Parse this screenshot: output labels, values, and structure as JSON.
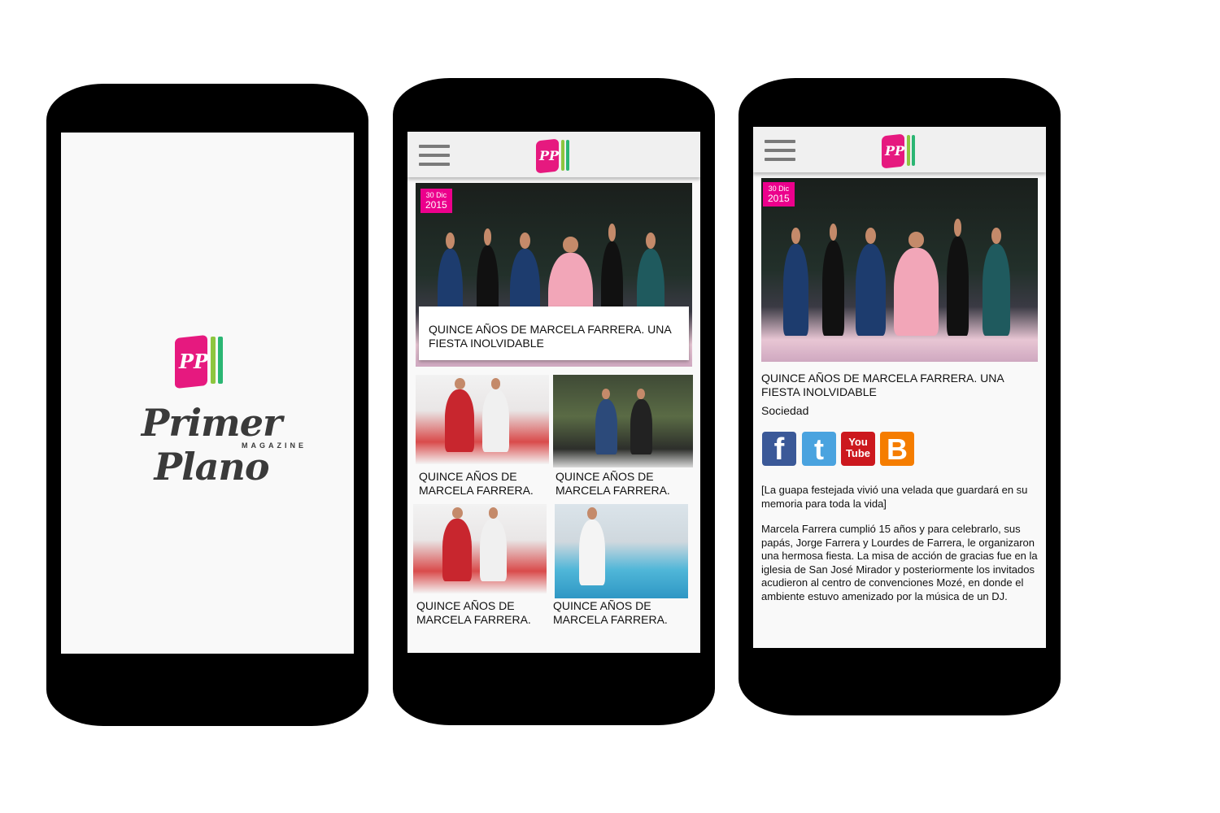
{
  "splash": {
    "logo_mark": "PP",
    "wordmark": "Primer Plano",
    "subtitle": "MAGAZINE"
  },
  "header": {
    "menu_icon": "hamburger-icon",
    "logo_mark": "PP"
  },
  "feed": {
    "hero": {
      "date_day": "30 Dic",
      "date_year": "2015",
      "title": "QUINCE AÑOS DE MARCELA FARRERA. UNA FIESTA INOLVIDABLE"
    },
    "cards": [
      {
        "title": "QUINCE AÑOS DE MARCELA FARRERA."
      },
      {
        "title": "QUINCE AÑOS DE MARCELA FARRERA."
      },
      {
        "title": "QUINCE AÑOS DE MARCELA FARRERA."
      },
      {
        "title": "QUINCE AÑOS DE MARCELA FARRERA."
      }
    ]
  },
  "article": {
    "date_day": "30 Dic",
    "date_year": "2015",
    "title": "QUINCE AÑOS DE MARCELA FARRERA. UNA FIESTA INOLVIDABLE",
    "category": "Sociedad",
    "social": {
      "facebook": "f",
      "twitter": "t",
      "youtube": "You Tube",
      "blogger": "B"
    },
    "lead": "[La guapa festejada vivió una velada que guardará en su memoria para toda la vida]",
    "body": "Marcela Farrera cumplió 15 años y para celebrarlo, sus papás, Jorge Farrera y Lourdes de Farrera, le organizaron una hermosa fiesta. La misa de acción de gracias fue en la iglesia de San José Mirador y posteriormente los invitados acudieron al centro de convenciones Mozé, en donde el ambiente estuvo amenizado por la música de un DJ."
  },
  "colors": {
    "brand_pink": "#ec008c",
    "brand_green": "#8dc63f",
    "brand_teal": "#2bb673"
  }
}
